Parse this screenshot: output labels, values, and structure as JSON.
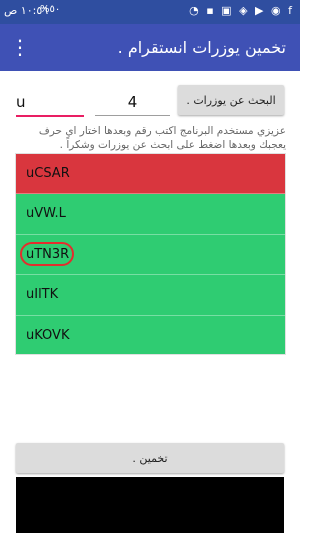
{
  "status_bar": {
    "time": "١٠:٥٦ ص",
    "battery": "%٥٠",
    "icons": [
      "facebook-icon",
      "messenger-icon",
      "youtube-icon",
      "photos-icon",
      "shield-icon",
      "photos-icon",
      "location-icon",
      "wifi-icon"
    ]
  },
  "app_bar": {
    "title": "تخمين يوزرات انستقرام .",
    "menu_icon": "more-vertical-icon"
  },
  "controls": {
    "search_label": "البحث عن يوزرات .",
    "count_value": "4",
    "letters_value": "u"
  },
  "info_text": "عزيزي مستخدم البرنامج اكتب رقم وبعدها اختار اي حرف يعجبك وبعدها اضغط على ابحث عن يوزرات وشكراً .",
  "results": [
    {
      "name": "uCSAR",
      "status": "red"
    },
    {
      "name": "uVW.L",
      "status": "green"
    },
    {
      "name": "uTN3R",
      "status": "green",
      "highlighted": true
    },
    {
      "name": "uIlTK",
      "status": "green"
    },
    {
      "name": "uKOVK",
      "status": "green"
    }
  ],
  "guess_button_label": "تخمين .",
  "colors": {
    "status_bar": "#2f4ea0",
    "app_bar": "#3f51b5",
    "taken": "#d9363e",
    "available": "#2fcc72",
    "highlight": "#e32d2d",
    "input_focus": "#e91e63"
  }
}
